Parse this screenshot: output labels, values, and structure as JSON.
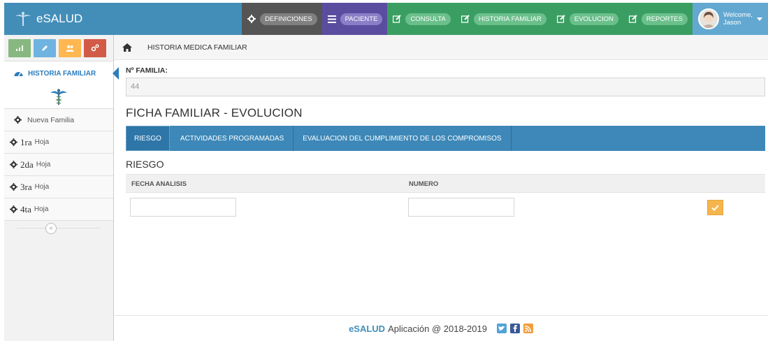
{
  "app": {
    "brand": "eSALUD"
  },
  "navbar": {
    "items": [
      {
        "label": "DEFINICIONES",
        "icon": "gear-icon"
      },
      {
        "label": "PACIENTE",
        "icon": "list-icon"
      },
      {
        "label": "CONSULTA",
        "icon": "edit-icon"
      },
      {
        "label": "HISTORIA FAMILIAR",
        "icon": "edit-icon"
      },
      {
        "label": "EVOLUCION",
        "icon": "edit-icon"
      },
      {
        "label": "REPORTES",
        "icon": "edit-icon"
      }
    ],
    "user": {
      "greeting": "Welcome,",
      "name": "Jason"
    }
  },
  "sidebar": {
    "shortcuts": [
      {
        "icon": "signal-icon",
        "color": "#87b87f"
      },
      {
        "icon": "pencil-icon",
        "color": "#6fb3e0"
      },
      {
        "icon": "users-icon",
        "color": "#ffb752"
      },
      {
        "icon": "cogs-icon",
        "color": "#d15b47"
      }
    ],
    "active": {
      "label": "HISTORIA FAMILIAR",
      "icon": "tachometer-icon"
    },
    "items": [
      {
        "label": "Nueva Familia"
      },
      {
        "num": "1ra",
        "sub": "Hoja"
      },
      {
        "num": "2da",
        "sub": "Hoja"
      },
      {
        "num": "3ra",
        "sub": "Hoja"
      },
      {
        "num": "4ta",
        "sub": "Hoja"
      }
    ]
  },
  "breadcrumb": {
    "label": "HISTORIA MEDICA FAMILIAR"
  },
  "form": {
    "familia_label": "Nº FAMILIA:",
    "familia_value": "44",
    "ficha_title": "FICHA FAMILIAR - EVOLUCION",
    "tabs": [
      "RIESGO",
      "ACTIVIDADES PROGRAMADAS",
      "EVALUACION DEL CUMPLIMIENTO DE LOS COMPROMISOS"
    ],
    "section_title": "RIESGO",
    "columns": [
      "FECHA ANALISIS",
      "NUMERO"
    ],
    "fecha_value": "",
    "numero_value": ""
  },
  "footer": {
    "brand": "eSALUD",
    "text": "Aplicación @ 2018-2019"
  },
  "colors": {
    "navbar": "#438eb9",
    "tabs": "#3d88b8",
    "accent": "#2b7dbc"
  }
}
